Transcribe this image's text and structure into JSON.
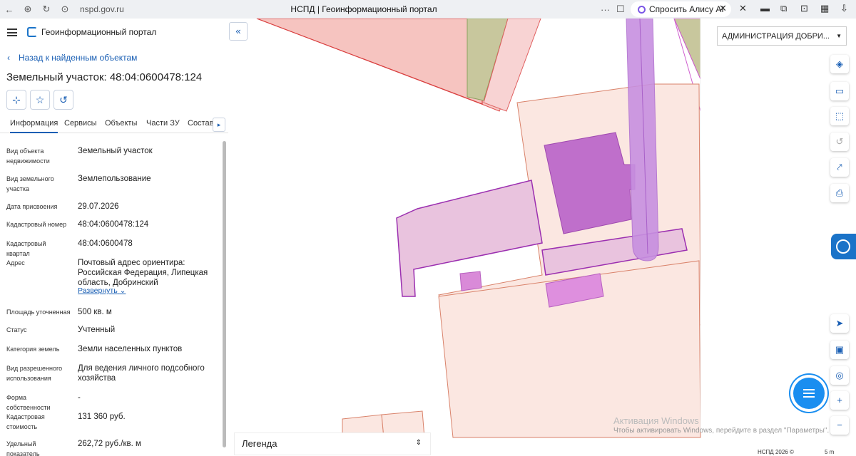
{
  "browser": {
    "url": "nspd.gov.ru",
    "title": "НСПД | Геоинформационный портал",
    "more": "···",
    "alice": "Спросить Алису AI"
  },
  "header": {
    "portal_name": "Геоинформационный портал",
    "back_label": "Назад к найденным объектам",
    "object_title": "Земельный участок: 48:04:0600478:124",
    "collapse": "«"
  },
  "tabs": [
    "Информация",
    "Сервисы",
    "Объекты",
    "Части ЗУ",
    "Состав"
  ],
  "tab_next": "▸",
  "properties": [
    {
      "key": "Вид объекта недвижимости",
      "value": "Земельный участок"
    },
    {
      "key": "Вид земельного участка",
      "value": "Землепользование"
    },
    {
      "key": "Дата присвоения",
      "value": "29.07.2026"
    },
    {
      "key": "Кадастровый номер",
      "value": "48:04:0600478:124"
    },
    {
      "key": "Кадастровый квартал",
      "value": "48:04:0600478"
    },
    {
      "key": "Адрес",
      "value": "Почтовый адрес ориентира: Российская Федерация, Липецкая область, Добринский"
    },
    {
      "key": "Площадь уточненная",
      "value": "500 кв. м"
    },
    {
      "key": "Статус",
      "value": "Учтенный"
    },
    {
      "key": "Категория земель",
      "value": "Земли населенных пунктов"
    },
    {
      "key": "Вид разрешенного использования",
      "value": "Для ведения личного подсобного хозяйства"
    },
    {
      "key": "Форма собственности",
      "value": "-"
    },
    {
      "key": "Кадастровая стоимость",
      "value": "131 360 руб."
    },
    {
      "key": "Удельный показатель кадастровой",
      "value": "262,72 руб./кв. м"
    }
  ],
  "expand_label": "Развернуть",
  "map": {
    "admin_select": "АДМИНИСТРАЦИЯ ДОБРИ...",
    "legend": "Легенда",
    "watermark_title": "Активация Windows",
    "watermark_text": "Чтобы активировать Windows, перейдите в раздел \"Параметры\".",
    "copyright": "НСПД 2026 ©",
    "scale": "5 m"
  },
  "icons": {
    "refresh": "refresh-icon",
    "bookmark": "bookmark-icon",
    "layers": "layers-icon",
    "ruler": "ruler-icon",
    "select": "select-area-icon",
    "history": "history-icon",
    "share": "share-icon",
    "print": "print-icon",
    "locate": "locate-icon",
    "chat": "chat-icon"
  },
  "colors": {
    "accent": "#1a5fb4",
    "parcel_fill": "#f9e3dc",
    "purple_zone": "#c38be0",
    "building": "#b86bc8"
  }
}
